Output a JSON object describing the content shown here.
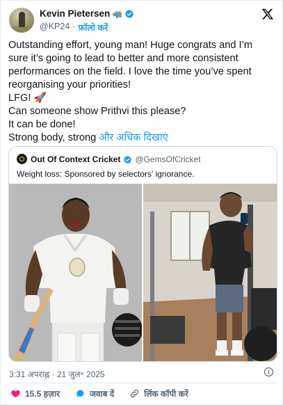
{
  "header": {
    "name": "Kevin Pietersen",
    "name_emoji": "🦏",
    "handle": "@KP24",
    "separator": "·",
    "follow_label": "फ़ॉलो करें"
  },
  "tweet": {
    "lines": [
      "Outstanding effort, young man! Huge congrats and I’m",
      "sure it’s going to lead to better and more consistent",
      "performances on the field. I love the time you’ve spent",
      "reorganising your priorities!",
      "LFG! 🚀",
      "Can someone show Prithvi this please?",
      "It can be done!"
    ],
    "last_line_text": "Strong body, strong ",
    "show_more_label": "और अधिक दिखाएं"
  },
  "quote": {
    "name": "Out Of Context Cricket",
    "handle": "@GemsOfCricket",
    "text": "Weight loss: Sponsored by selectors’ ignorance."
  },
  "footer": {
    "timestamp": "3:31 अपराह्न · 21 जुल॰ 2025",
    "likes": "15.5 हज़ार",
    "reply_label": "जवाब दें",
    "copy_link_label": "लिंक कॉपी करें"
  },
  "colors": {
    "accent": "#1d9bf0",
    "like": "#f91880",
    "text": "#0f1419",
    "muted": "#536471"
  },
  "icons": [
    "x-logo-icon",
    "verified-badge-icon",
    "info-icon",
    "heart-icon",
    "reply-bubble-icon",
    "link-icon"
  ]
}
